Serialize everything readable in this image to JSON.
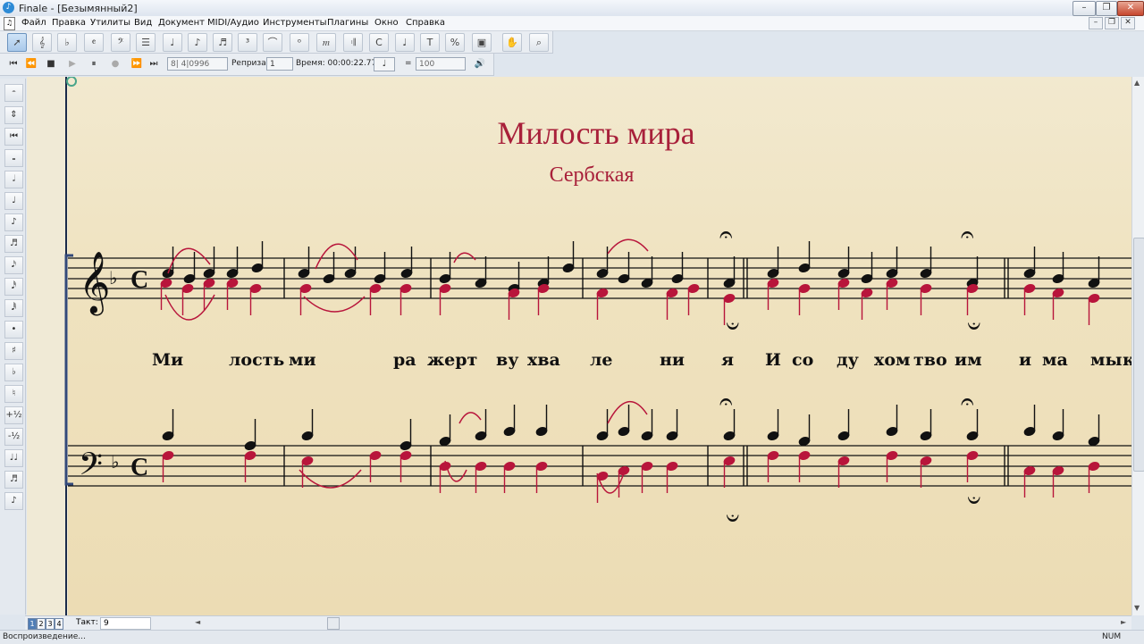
{
  "window": {
    "title": "Finale - [Безымянный2]",
    "controls": [
      "–",
      "❐",
      "✕"
    ]
  },
  "menu": {
    "items": [
      "Файл",
      "Правка",
      "Утилиты",
      "Вид",
      "Документ",
      "MIDI/Аудио",
      "Инструменты",
      "Плагины",
      "Окно",
      "Справка"
    ],
    "mdi_controls": [
      "–",
      "❐",
      "✕"
    ]
  },
  "tools": [
    "selection-tool",
    "staff-tool",
    "key-signature-tool",
    "time-signature-tool",
    "clef-tool",
    "measure-tool",
    "note-mover-tool",
    "simple-entry-tool",
    "speedy-entry-tool",
    "tuplet-tool",
    "smart-shape-tool",
    "articulation-tool",
    "expression-tool",
    "repeat-tool",
    "chord-tool",
    "lyrics-tool",
    "text-tool",
    "resize-tool",
    "page-layout-tool",
    "hand-grabber-tool",
    "zoom-tool"
  ],
  "playback": {
    "position": "8| 4|0996",
    "repeat_label": "Реприза:",
    "repeat_value": "1",
    "time_label": "Время: 00:00:22.778",
    "tempo_eq": "=",
    "tempo_value": "100"
  },
  "left_palette": [
    "𝄼",
    "⇕",
    "⏮",
    "𝅝",
    "𝅗𝅥",
    "♩",
    "♪",
    "♬",
    "𝅘𝅥𝅯",
    "𝅘𝅥𝅰",
    "𝅘𝅥𝅱",
    "•",
    "♯",
    "♭",
    "♮",
    "+½",
    "-½",
    "♩♩",
    "♬",
    "♪"
  ],
  "score": {
    "title": "Милость мира",
    "subtitle": "Сербская",
    "lyrics": [
      "Ми",
      "лость",
      "ми",
      "ра",
      "жерт",
      "ву",
      "хва",
      "ле",
      "ни",
      "я",
      "И",
      "со",
      "ду",
      "хом",
      "тво",
      "им",
      "и",
      "ма",
      "мы",
      "к"
    ],
    "colors": {
      "black_voice": "#111111",
      "red_voice": "#b8153b",
      "title": "#a8203a"
    }
  },
  "scroll": {
    "page_tabs": [
      "1",
      "2",
      "3",
      "4"
    ],
    "measure_label": "Такт:",
    "measure_value": "9"
  },
  "status": {
    "text": "Воспроизведение...",
    "num": "NUM"
  }
}
